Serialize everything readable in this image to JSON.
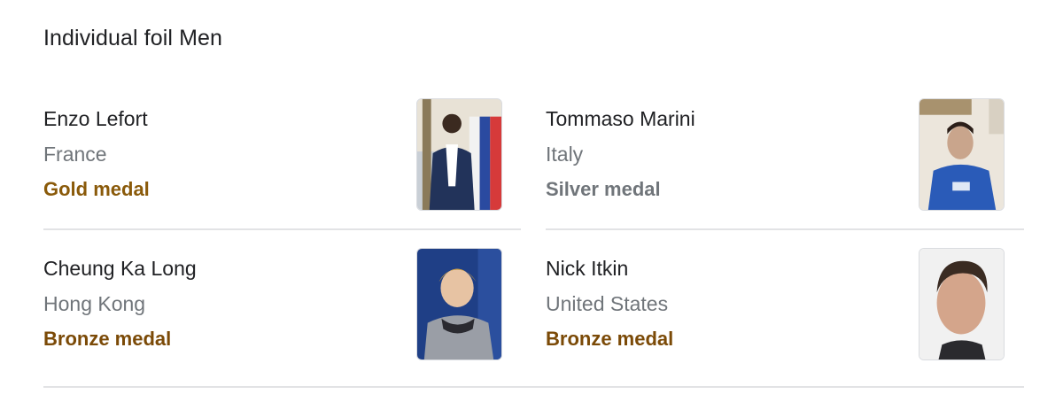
{
  "title": "Individual foil Men",
  "medalists": [
    {
      "name": "Enzo Lefort",
      "country": "France",
      "medal": "Gold medal",
      "medal_color": "#8a5a0a"
    },
    {
      "name": "Tommaso Marini",
      "country": "Italy",
      "medal": "Silver medal",
      "medal_color": "#70757a"
    },
    {
      "name": "Cheung Ka Long",
      "country": "Hong Kong",
      "medal": "Bronze medal",
      "medal_color": "#7b4a07"
    },
    {
      "name": "Nick Itkin",
      "country": "United States",
      "medal": "Bronze medal",
      "medal_color": "#7b4a07"
    }
  ]
}
